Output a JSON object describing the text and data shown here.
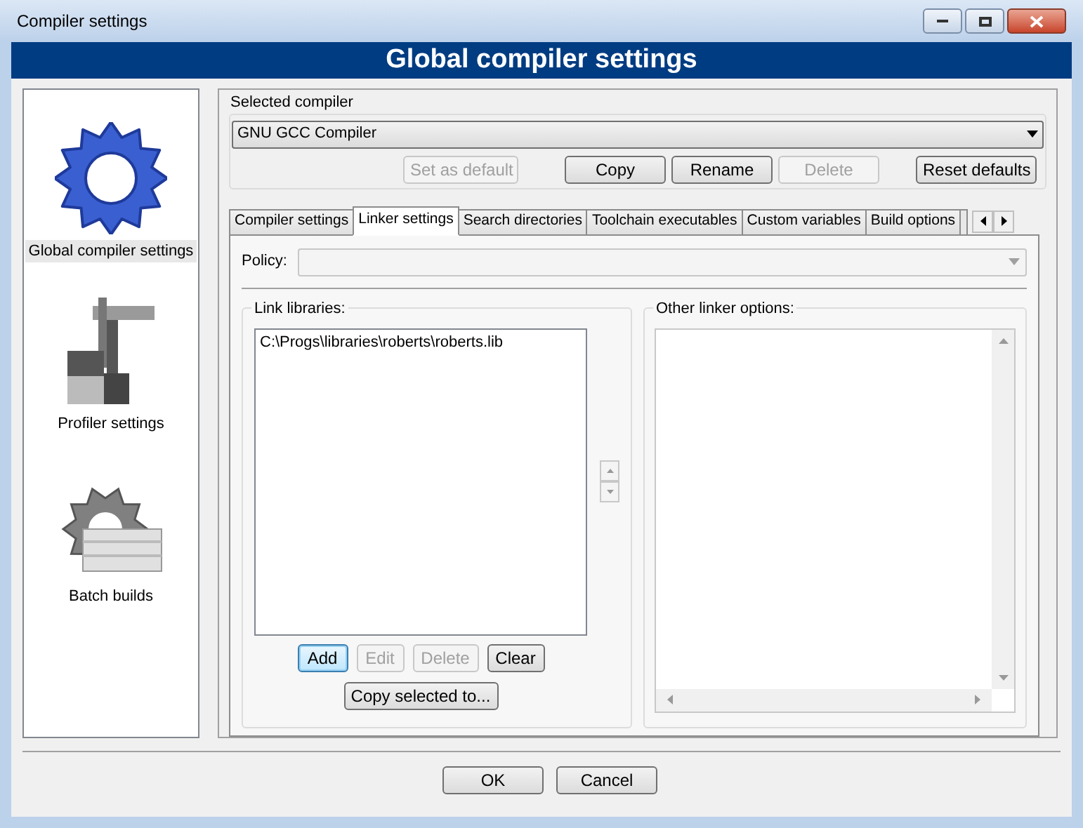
{
  "window": {
    "title": "Compiler settings"
  },
  "header": "Global compiler settings",
  "sidebar": {
    "items": [
      {
        "label": "Global compiler settings",
        "kind": "gear",
        "selected": true
      },
      {
        "label": "Profiler settings",
        "kind": "caliper",
        "selected": false
      },
      {
        "label": "Batch builds",
        "kind": "stack",
        "selected": false
      }
    ]
  },
  "selected_compiler": {
    "label": "Selected compiler",
    "value": "GNU GCC Compiler"
  },
  "compiler_buttons": [
    {
      "label": "Set as default",
      "disabled": true
    },
    {
      "label": "Copy",
      "disabled": false
    },
    {
      "label": "Rename",
      "disabled": false
    },
    {
      "label": "Delete",
      "disabled": true
    },
    {
      "label": "Reset defaults",
      "disabled": false
    }
  ],
  "tabs": [
    {
      "label": "Compiler settings",
      "selected": false
    },
    {
      "label": "Linker settings",
      "selected": true
    },
    {
      "label": "Search directories",
      "selected": false
    },
    {
      "label": "Toolchain executables",
      "selected": false
    },
    {
      "label": "Custom variables",
      "selected": false
    },
    {
      "label": "Build options",
      "selected": false
    }
  ],
  "policy": {
    "label": "Policy:"
  },
  "link_libraries": {
    "label": "Link libraries:",
    "items": [
      "C:\\Progs\\libraries\\roberts\\roberts.lib"
    ],
    "buttons": [
      {
        "label": "Add",
        "disabled": false,
        "focused": true
      },
      {
        "label": "Edit",
        "disabled": true,
        "focused": false
      },
      {
        "label": "Delete",
        "disabled": true,
        "focused": false
      },
      {
        "label": "Clear",
        "disabled": false,
        "focused": false
      }
    ],
    "copy_button": "Copy selected to..."
  },
  "other_linker_options": {
    "label": "Other linker options:"
  },
  "footer_buttons": [
    "OK",
    "Cancel"
  ]
}
